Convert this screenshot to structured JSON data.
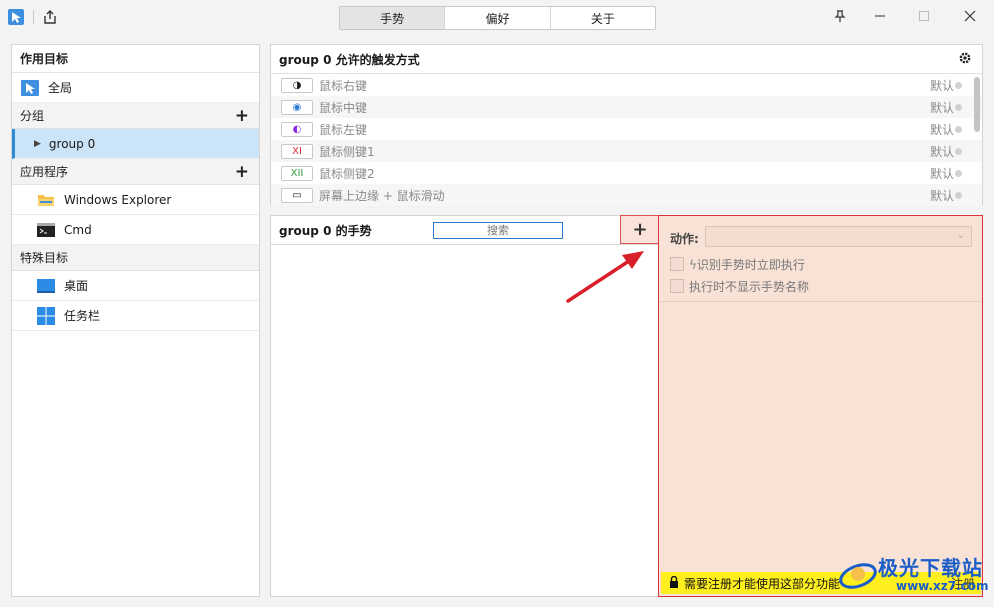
{
  "tabs": [
    "手势",
    "偏好",
    "关于"
  ],
  "active_tab": 0,
  "left": {
    "target_header": "作用目标",
    "global_label": "全局",
    "group_header": "分组",
    "group_item": "group 0",
    "apps_header": "应用程序",
    "apps": [
      "Windows Explorer",
      "Cmd"
    ],
    "special_header": "特殊目标",
    "special": [
      "桌面",
      "任务栏"
    ]
  },
  "triggers": {
    "title": "group 0 允许的触发方式",
    "rows": [
      {
        "icon": "◑",
        "label": "鼠标右键",
        "default": "默认"
      },
      {
        "icon": "◉",
        "label": "鼠标中键",
        "default": "默认"
      },
      {
        "icon": "◐",
        "label": "鼠标左键",
        "default": "默认"
      },
      {
        "icon": "XI",
        "label": "鼠标侧键1",
        "default": "默认"
      },
      {
        "icon": "XII",
        "label": "鼠标侧键2",
        "default": "默认"
      },
      {
        "icon": "▭",
        "label": "屏幕上边缘 + 鼠标滑动",
        "default": "默认"
      }
    ]
  },
  "gestures": {
    "title": "group 0 的手势",
    "search_placeholder": "搜索",
    "add_label": "+"
  },
  "detail": {
    "action_label": "动作:",
    "check1": "识别手势时立即执行",
    "check2": "执行时不显示手势名称",
    "register_notice": "需要注册才能使用这部分功能",
    "register_link": "注册"
  },
  "watermark": {
    "text": "极光下载站",
    "url": "www.xz7.com"
  },
  "colors": {
    "accent": "#2f8ad8",
    "selected_bg": "#cce4f7",
    "disabled_panel": "#f8e2d6",
    "highlight_border": "#d9323a",
    "register_bar": "#ffef1e"
  }
}
